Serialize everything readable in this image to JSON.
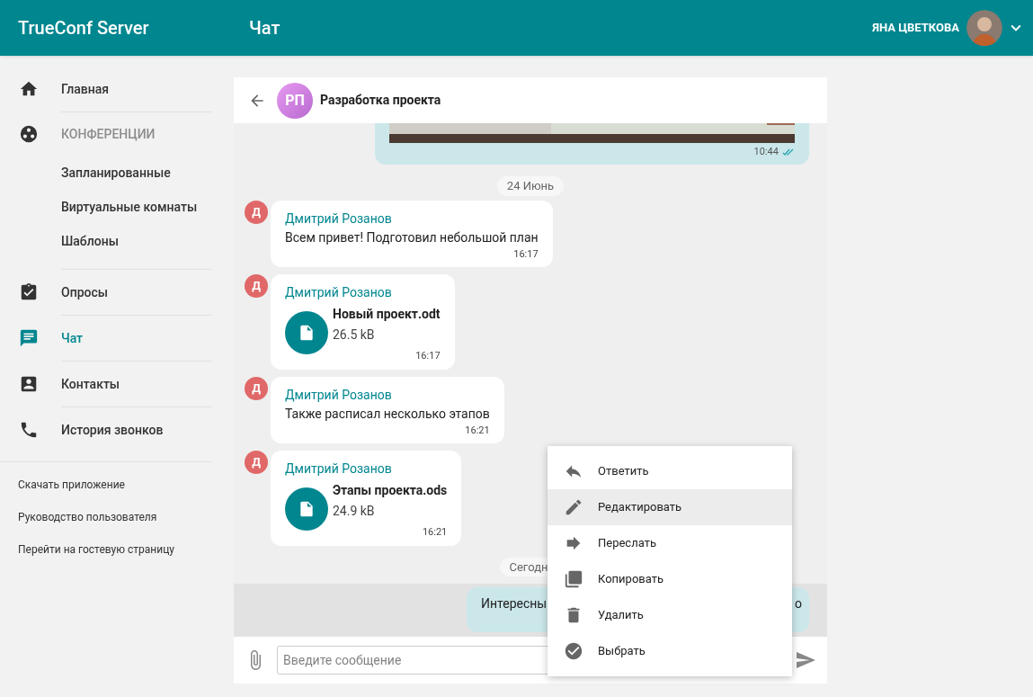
{
  "header": {
    "app_title": "TrueConf Server",
    "page_title": "Чат",
    "user_name": "ЯНА ЦВЕТКОВА"
  },
  "sidebar": {
    "items": [
      {
        "label": "Главная",
        "kind": "home",
        "selected": false
      },
      {
        "label": "КОНФЕРЕНЦИИ",
        "kind": "conferences",
        "selected": false,
        "children": [
          {
            "label": "Запланированные"
          },
          {
            "label": "Виртуальные комнаты"
          },
          {
            "label": "Шаблоны"
          }
        ]
      },
      {
        "label": "Опросы",
        "kind": "polls",
        "selected": false
      },
      {
        "label": "Чат",
        "kind": "chat",
        "selected": true
      },
      {
        "label": "Контакты",
        "kind": "contacts",
        "selected": false
      },
      {
        "label": "История звонков",
        "kind": "phone",
        "selected": false
      }
    ],
    "links": [
      "Скачать приложение",
      "Руководство пользователя",
      "Перейти на гостевую страницу"
    ]
  },
  "chat": {
    "title": "Разработка проекта",
    "avatar_initials": "РП",
    "messages": [
      {
        "time": "10:44",
        "read": true
      },
      {
        "kind": "date",
        "text": "24 Июнь"
      },
      {
        "kind": "text",
        "initial": "Д",
        "sender": "Дмитрий Розанов",
        "text": "Всем привет! Подготовил небольшой план",
        "time": "16:17"
      },
      {
        "kind": "file",
        "initial": "Д",
        "sender": "Дмитрий Розанов",
        "file_name": "Новый проект.odt",
        "size": "26.5 kB",
        "time": "16:17"
      },
      {
        "kind": "text",
        "initial": "Д",
        "sender": "Дмитрий Розанов",
        "text": "Также расписал несколько этапов",
        "time": "16:21"
      },
      {
        "kind": "file",
        "initial": "Д",
        "sender": "Дмитрий Розанов",
        "file_name": "Этапы проекта.ods",
        "size": "24.9 kB",
        "time": "16:21"
      },
      {
        "kind": "date",
        "text": "Сегодн"
      },
      {
        "kind": "outgoing",
        "text": "Интересны",
        "tail": "о",
        "selected": true
      }
    ],
    "input_placeholder": "Введите сообщение"
  },
  "context_menu": {
    "items": [
      {
        "label": "Ответить",
        "kind": "reply",
        "selected": false
      },
      {
        "label": "Редактировать",
        "kind": "edit",
        "selected": true
      },
      {
        "label": "Переслать",
        "kind": "forward",
        "selected": false
      },
      {
        "label": "Копировать",
        "kind": "copy",
        "selected": false
      },
      {
        "label": "Удалить",
        "kind": "delete",
        "selected": false
      },
      {
        "label": "Выбрать",
        "kind": "check",
        "selected": false
      }
    ]
  }
}
